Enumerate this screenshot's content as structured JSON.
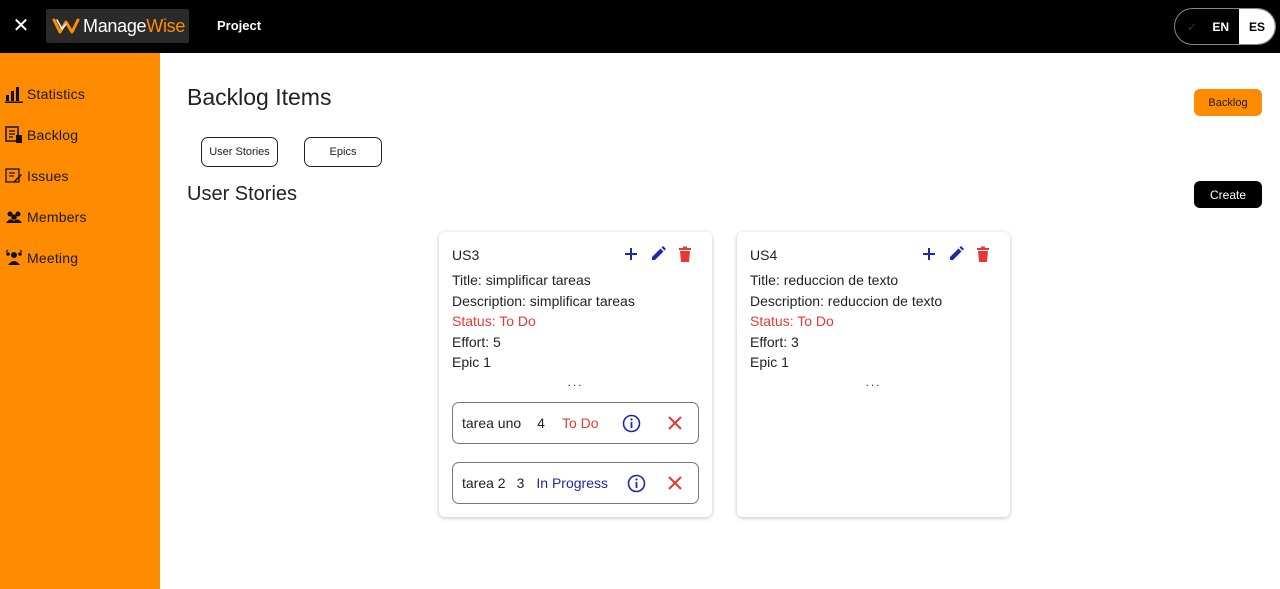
{
  "header": {
    "logo_part1": "Manage",
    "logo_part2": "Wise",
    "project_label": "Project",
    "lang_en": "EN",
    "lang_es": "ES",
    "selected_lang": "ES"
  },
  "sidebar": {
    "items": [
      {
        "label": "Statistics",
        "icon": "bar-chart-icon"
      },
      {
        "label": "Backlog",
        "icon": "backlog-icon"
      },
      {
        "label": "Issues",
        "icon": "issues-icon"
      },
      {
        "label": "Members",
        "icon": "members-icon"
      },
      {
        "label": "Meeting",
        "icon": "meeting-icon"
      }
    ]
  },
  "main": {
    "title": "Backlog Items",
    "backlog_button": "Backlog",
    "tabs": [
      "User Stories",
      "Epics"
    ],
    "section_title": "User Stories",
    "create_button": "Create"
  },
  "cards": [
    {
      "id": "US3",
      "title": "Title: simplificar tareas",
      "description": "Description: simplificar tareas",
      "status": "Status: To Do",
      "effort": "Effort: 5",
      "epic": "Epic 1",
      "more": "...",
      "tasks": [
        {
          "name": "tarea uno",
          "effort": "4",
          "status": "To Do"
        },
        {
          "name": "tarea 2",
          "effort": "3",
          "status": "In Progress"
        }
      ]
    },
    {
      "id": "US4",
      "title": "Title: reduccion de texto",
      "description": "Description: reduccion de texto",
      "status": "Status: To Do",
      "effort": "Effort: 3",
      "epic": "Epic 1",
      "more": "...",
      "tasks": []
    }
  ],
  "colors": {
    "accent": "#FF8C00",
    "header_bg": "#000000",
    "status_todo": "#e53935",
    "status_in_progress": "#1a2aa8",
    "action_blue": "#1a2aa8",
    "action_red": "#e53935"
  }
}
